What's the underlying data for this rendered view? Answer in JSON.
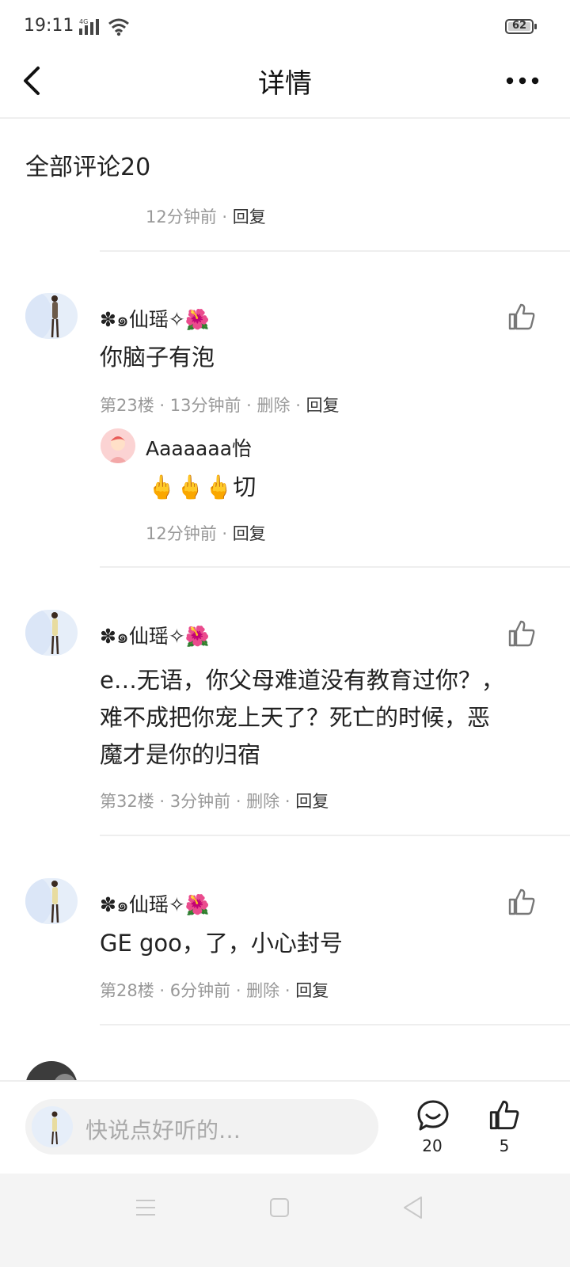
{
  "status_bar": {
    "time": "19:11",
    "network": "4G",
    "battery": "62"
  },
  "header": {
    "title": "详情"
  },
  "section": {
    "title": "全部评论20"
  },
  "top_partial": {
    "time": "12分钟前",
    "reply": "回复"
  },
  "comments": [
    {
      "username": "✽๑仙瑶✧🌺",
      "text_lines": [
        "你脑子有泡"
      ],
      "floor": "第23楼",
      "time": "13分钟前",
      "delete": "删除",
      "reply": "回复",
      "sub_reply": {
        "username": "Aaaaaaa怡",
        "text": "🖕🖕🖕切",
        "time": "12分钟前",
        "reply": "回复"
      }
    },
    {
      "username": "✽๑仙瑶✧🌺",
      "text_lines": [
        "e…无语，你父母难道没有教育过你？，",
        "难不成把你宠上天了？死亡的时候，恶",
        "魔才是你的归宿"
      ],
      "floor": "第32楼",
      "time": "3分钟前",
      "delete": "删除",
      "reply": "回复"
    },
    {
      "username": "✽๑仙瑶✧🌺",
      "text_lines": [
        "GE goo，了，小心封号"
      ],
      "floor": "第28楼",
      "time": "6分钟前",
      "delete": "删除",
      "reply": "回复"
    }
  ],
  "bottom_bar": {
    "input_placeholder": "快说点好听的…",
    "comment_count": "20",
    "like_count": "5"
  },
  "icons": {
    "back": "back-arrow-icon",
    "more": "more-dots-icon",
    "like": "thumbs-up-icon",
    "comment": "comment-bubble-icon",
    "nav_menu": "menu-icon",
    "nav_home": "home-square-icon",
    "nav_back": "back-triangle-icon"
  }
}
